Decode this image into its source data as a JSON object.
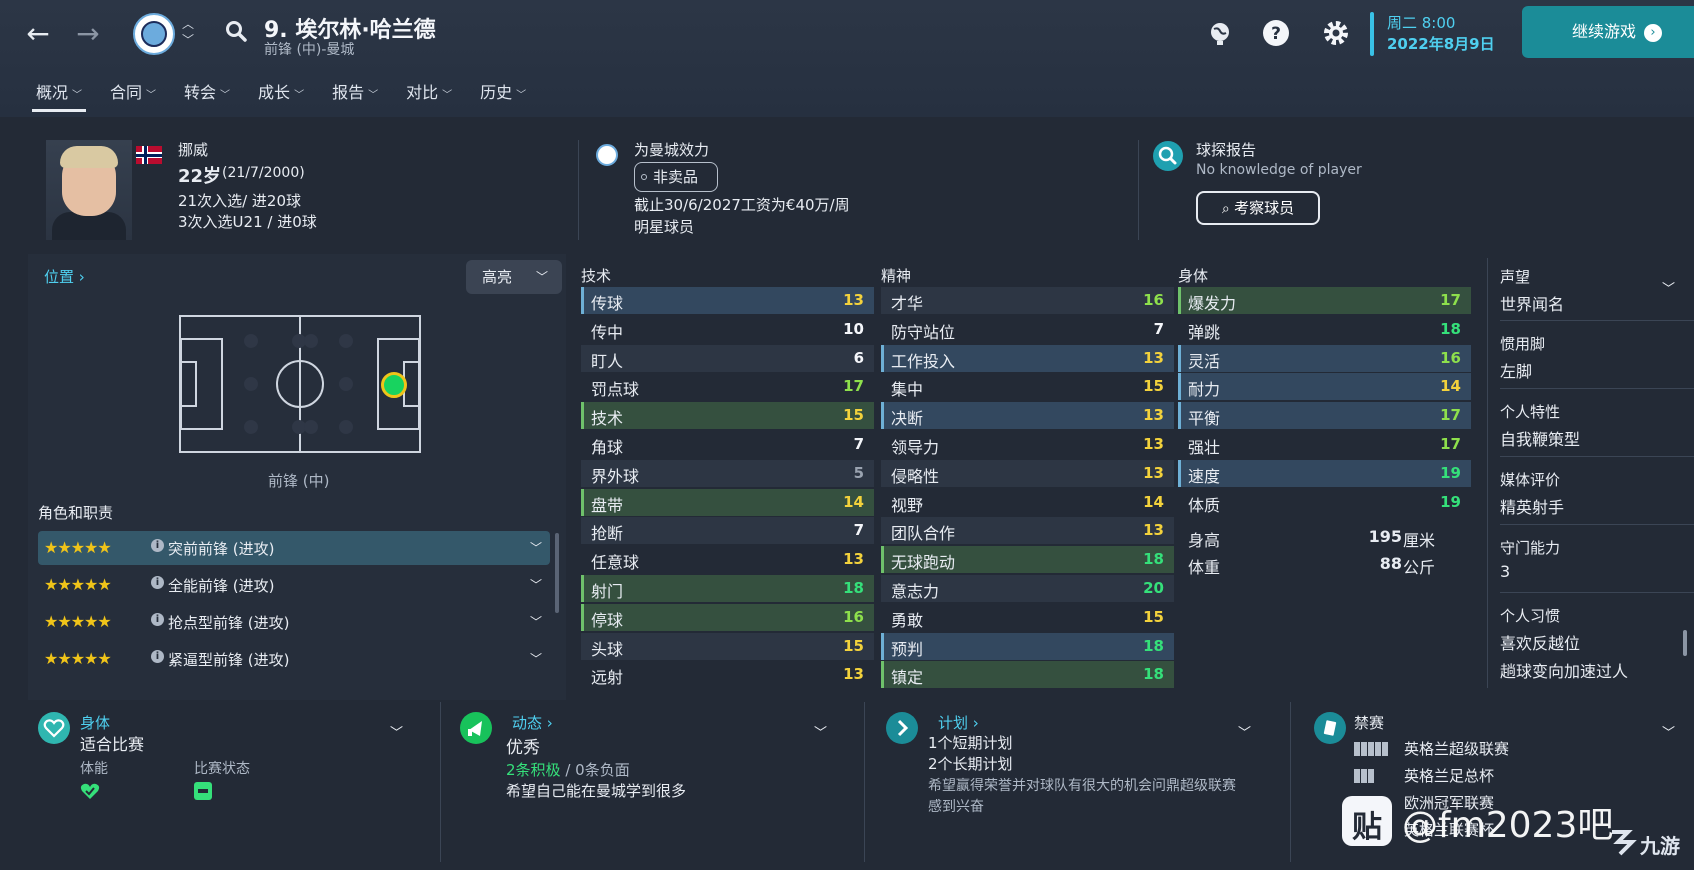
{
  "header": {
    "player_title": "9. 埃尔林·哈兰德",
    "player_subtitle": "前锋 (中)-曼城",
    "date_line1": "周二 8:00",
    "date_line2": "2022年8月9日",
    "continue_label": "继续游戏"
  },
  "menu": [
    {
      "label": "概况",
      "active": true
    },
    {
      "label": "合同"
    },
    {
      "label": "转会"
    },
    {
      "label": "成长"
    },
    {
      "label": "报告"
    },
    {
      "label": "对比"
    },
    {
      "label": "历史"
    }
  ],
  "profile": {
    "nation": "挪威",
    "age": "22岁",
    "dob": "(21/7/2000)",
    "caps": "21次入选/ 进20球",
    "u21": "3次入选U21 / 进0球"
  },
  "club": {
    "plays_for": "为曼城效力",
    "status": "非卖品",
    "contract": "截止30/6/2027工资为€40万/周",
    "type": "明星球员"
  },
  "scout": {
    "title": "球探报告",
    "subtitle": "No knowledge of player",
    "button": "考察球员"
  },
  "position": {
    "link": "位置",
    "highlight": "高亮",
    "label": "前锋 (中)"
  },
  "roles": {
    "title": "角色和职责",
    "items": [
      {
        "name": "突前前锋 (进攻)",
        "stars": "★★★★★",
        "selected": true
      },
      {
        "name": "全能前锋 (进攻)",
        "stars": "★★★★★"
      },
      {
        "name": "抢点型前锋 (进攻)",
        "stars": "★★★★★"
      },
      {
        "name": "紧逼型前锋 (进攻)",
        "stars": "★★★★★"
      }
    ]
  },
  "attributes": {
    "technical": {
      "title": "技术",
      "items": [
        {
          "name": "传球",
          "value": "13",
          "hl": "blue"
        },
        {
          "name": "传中",
          "value": "10"
        },
        {
          "name": "盯人",
          "value": "6"
        },
        {
          "name": "罚点球",
          "value": "17"
        },
        {
          "name": "技术",
          "value": "15",
          "hl": "green"
        },
        {
          "name": "角球",
          "value": "7"
        },
        {
          "name": "界外球",
          "value": "5"
        },
        {
          "name": "盘带",
          "value": "14",
          "hl": "green"
        },
        {
          "name": "抢断",
          "value": "7"
        },
        {
          "name": "任意球",
          "value": "13"
        },
        {
          "name": "射门",
          "value": "18",
          "hl": "green"
        },
        {
          "name": "停球",
          "value": "16",
          "hl": "green"
        },
        {
          "name": "头球",
          "value": "15"
        },
        {
          "name": "远射",
          "value": "13"
        }
      ]
    },
    "mental": {
      "title": "精神",
      "items": [
        {
          "name": "才华",
          "value": "16"
        },
        {
          "name": "防守站位",
          "value": "7"
        },
        {
          "name": "工作投入",
          "value": "13",
          "hl": "blue"
        },
        {
          "name": "集中",
          "value": "15"
        },
        {
          "name": "决断",
          "value": "13",
          "hl": "blue"
        },
        {
          "name": "领导力",
          "value": "13"
        },
        {
          "name": "侵略性",
          "value": "13"
        },
        {
          "name": "视野",
          "value": "14"
        },
        {
          "name": "团队合作",
          "value": "13"
        },
        {
          "name": "无球跑动",
          "value": "18",
          "hl": "green"
        },
        {
          "name": "意志力",
          "value": "20"
        },
        {
          "name": "勇敢",
          "value": "15"
        },
        {
          "name": "预判",
          "value": "18",
          "hl": "blue"
        },
        {
          "name": "镇定",
          "value": "18",
          "hl": "green"
        }
      ]
    },
    "physical": {
      "title": "身体",
      "items": [
        {
          "name": "爆发力",
          "value": "17",
          "hl": "green"
        },
        {
          "name": "弹跳",
          "value": "18"
        },
        {
          "name": "灵活",
          "value": "16",
          "hl": "blue"
        },
        {
          "name": "耐力",
          "value": "14",
          "hl": "blue"
        },
        {
          "name": "平衡",
          "value": "17",
          "hl": "blue"
        },
        {
          "name": "强壮",
          "value": "17"
        },
        {
          "name": "速度",
          "value": "19",
          "hl": "blue"
        },
        {
          "name": "体质",
          "value": "19"
        }
      ],
      "height_label": "身高",
      "height_num": "195",
      "height_unit": "厘米",
      "weight_label": "体重",
      "weight_num": "88",
      "weight_unit": "公斤"
    }
  },
  "side": {
    "reputation_label": "声望",
    "reputation": "世界闻名",
    "foot_label": "惯用脚",
    "foot": "左脚",
    "trait_label": "个人特性",
    "trait": "自我鞭策型",
    "media_label": "媒体评价",
    "media": "精英射手",
    "gk_label": "守门能力",
    "gk": "3",
    "habits_label": "个人习惯",
    "habit1": "喜欢反越位",
    "habit2": "趟球变向加速过人"
  },
  "bottom": {
    "body_title": "身体",
    "body_status": "适合比赛",
    "fitness_label": "体能",
    "match_label": "比赛状态",
    "dyn_title": "动态",
    "dyn_status": "优秀",
    "positive": "2条积极",
    "separator": "/",
    "negative": "0条负面",
    "dyn_desc": "希望自己能在曼城学到很多",
    "plan_title": "计划",
    "plan_short": "1个短期计划",
    "plan_long": "2个长期计划",
    "plan_desc1": "希望赢得荣誉并对球队有很大的机会问鼎超级联赛",
    "plan_desc2": "感到兴奋",
    "ban_title": "禁赛",
    "comp1": "英格兰超级联赛",
    "comp2": "英格兰足总杯",
    "comp3": "欧洲冠军联赛",
    "comp4": "英格兰联赛杯"
  },
  "watermark": {
    "text": "@fm2023吧",
    "brand": "九游"
  },
  "colors": {
    "accent": "#4fd0f0",
    "continue_bg": "#1b8c98",
    "star": "#f0c419",
    "high_value": "#35e07a"
  }
}
